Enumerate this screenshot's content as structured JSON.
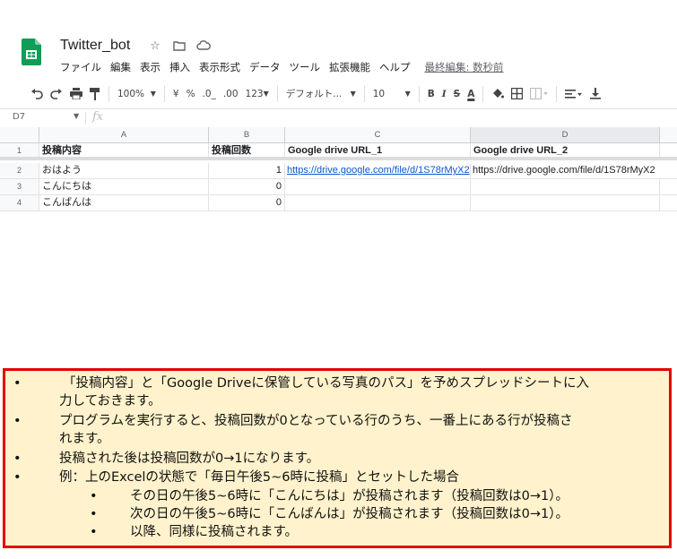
{
  "doc": {
    "title": "Twitter_bot",
    "menus": [
      "ファイル",
      "編集",
      "表示",
      "挿入",
      "表示形式",
      "データ",
      "ツール",
      "拡張機能",
      "ヘルプ"
    ],
    "last_edit": "最終編集: 数秒前"
  },
  "toolbar": {
    "zoom": "100%",
    "currency": "¥",
    "percent": "%",
    "dec_decrease": ".0_",
    "dec_increase": ".00",
    "number_format": "123",
    "font": "デフォルト...",
    "font_size": "10",
    "bold": "B",
    "italic": "I",
    "strike": "S",
    "text_color": "A"
  },
  "formula_bar": {
    "cell_ref": "D7",
    "fx": "fx"
  },
  "grid": {
    "columns": [
      "A",
      "B",
      "C",
      "D"
    ],
    "rows": [
      {
        "num": "1",
        "a": "投稿内容",
        "b": "投稿回数",
        "c": "Google drive URL_1",
        "d": "Google drive URL_2"
      },
      {
        "num": "2",
        "a": "おはよう",
        "b": "1",
        "c": "https://drive.google.com/file/d/1S78rMyX2",
        "d": "https://drive.google.com/file/d/1S78rMyX2"
      },
      {
        "num": "3",
        "a": "こんにちは",
        "b": "0",
        "c": "",
        "d": ""
      },
      {
        "num": "4",
        "a": "こんばんは",
        "b": "0",
        "c": "",
        "d": ""
      }
    ]
  },
  "note": {
    "bullet": "•",
    "line1a": "「投稿内容」と「Google Driveに保管している写真のパス」を予めスプレッドシートに入",
    "line1b": "力しておきます。",
    "line2a": "プログラムを実行すると、投稿回数が0となっている行のうち、一番上にある行が投稿さ",
    "line2b": "れます。",
    "line3": "投稿された後は投稿回数が0→1になります。",
    "line4": "例：上のExcelの状態で「毎日午後5~6時に投稿」とセットした場合",
    "sub1": "その日の午後5~6時に「こんにちは」が投稿されます（投稿回数は0→1）。",
    "sub2": "次の日の午後5~6時に「こんばんは」が投稿されます（投稿回数は0→1）。",
    "sub3": "以降、同様に投稿されます。"
  },
  "colors": {
    "accent_red": "#e50000",
    "note_bg": "#fff2cc",
    "sheets_green": "#0f9d58",
    "link": "#1155cc"
  }
}
